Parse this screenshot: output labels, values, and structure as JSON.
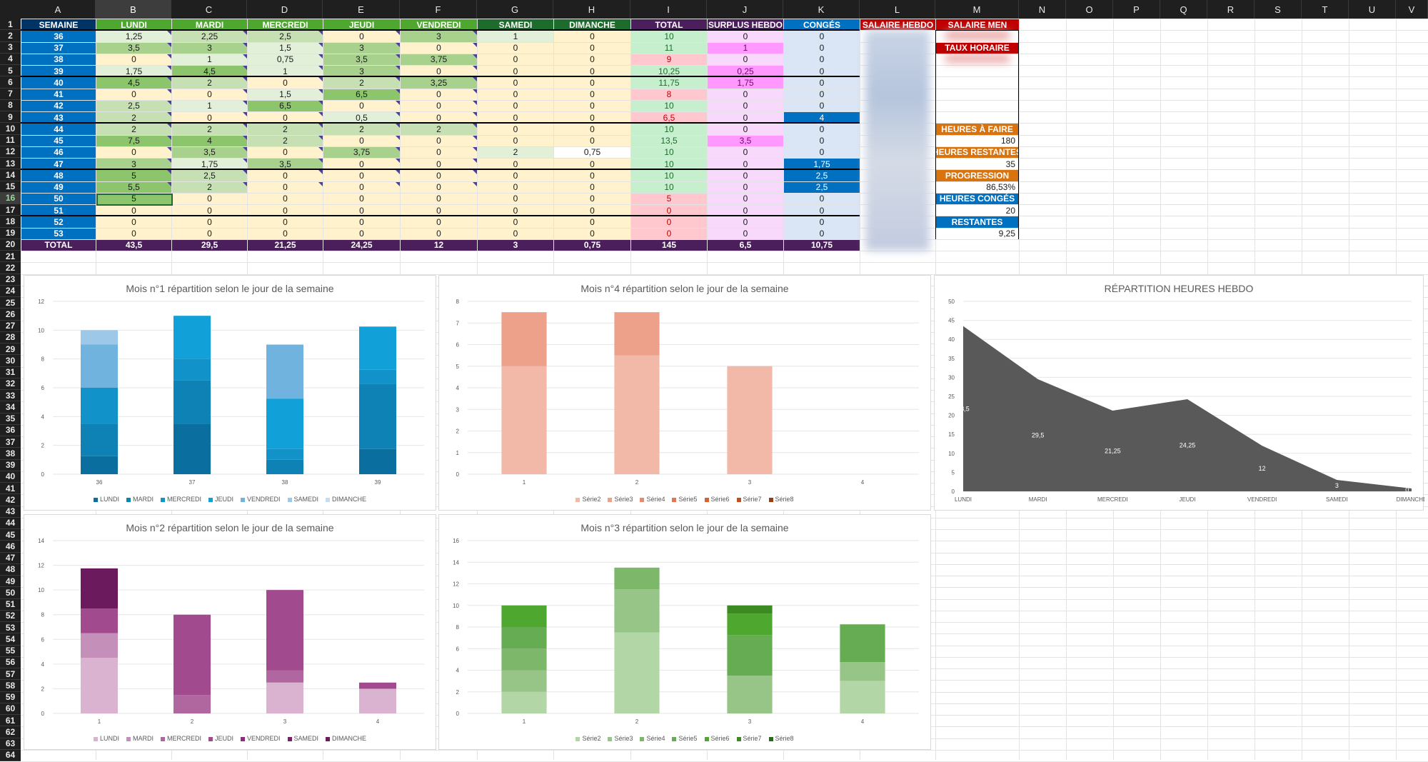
{
  "columns": [
    "A",
    "B",
    "C",
    "D",
    "E",
    "F",
    "G",
    "H",
    "I",
    "J",
    "K",
    "L",
    "M",
    "N",
    "O",
    "P",
    "Q",
    "R",
    "S",
    "T",
    "U",
    "V"
  ],
  "selected_column": "B",
  "selected_row": "16",
  "rows": [
    "1",
    "2",
    "3",
    "4",
    "5",
    "6",
    "7",
    "8",
    "9",
    "10",
    "11",
    "12",
    "13",
    "14",
    "15",
    "16",
    "17",
    "18",
    "19",
    "20",
    "21",
    "22",
    "23",
    "24",
    "25",
    "26",
    "27",
    "28",
    "29",
    "30",
    "31",
    "32",
    "33",
    "34",
    "35",
    "36",
    "37",
    "38",
    "39",
    "40",
    "41",
    "42",
    "43",
    "44",
    "45",
    "46",
    "47",
    "48",
    "49",
    "50",
    "51",
    "52",
    "53",
    "54",
    "55",
    "56",
    "57",
    "58",
    "59",
    "60",
    "61",
    "62",
    "63",
    "64"
  ],
  "table": {
    "headers": [
      "SEMAINE",
      "LUNDI",
      "MARDI",
      "MERCREDI",
      "JEUDI",
      "VENDREDI",
      "SAMEDI",
      "DIMANCHE",
      "TOTAL",
      "SURPLUS HEBDO",
      "CONGÉS",
      "SALAIRE HEBDO",
      "SALAIRE MEN"
    ],
    "header_colors": [
      "#003366",
      "#4ea72e",
      "#4ea72e",
      "#4ea72e",
      "#4ea72e",
      "#4ea72e",
      "#1e6b2e",
      "#1e6b2e",
      "#4b1f5c",
      "#4b1f5c",
      "#0070c0",
      "#c00000",
      "#c00000"
    ],
    "data": [
      [
        "36",
        "1,25",
        "2,25",
        "2,5",
        "0",
        "3",
        "1",
        "0",
        "10",
        "0",
        "0"
      ],
      [
        "37",
        "3,5",
        "3",
        "1,5",
        "3",
        "0",
        "0",
        "0",
        "11",
        "1",
        "0"
      ],
      [
        "38",
        "0",
        "1",
        "0,75",
        "3,5",
        "3,75",
        "0",
        "0",
        "9",
        "0",
        "0"
      ],
      [
        "39",
        "1,75",
        "4,5",
        "1",
        "3",
        "0",
        "0",
        "0",
        "10,25",
        "0,25",
        "0"
      ],
      [
        "40",
        "4,5",
        "2",
        "0",
        "2",
        "3,25",
        "0",
        "0",
        "11,75",
        "1,75",
        "0"
      ],
      [
        "41",
        "0",
        "0",
        "1,5",
        "6,5",
        "0",
        "0",
        "0",
        "8",
        "0",
        "0"
      ],
      [
        "42",
        "2,5",
        "1",
        "6,5",
        "0",
        "0",
        "0",
        "0",
        "10",
        "0",
        "0"
      ],
      [
        "43",
        "2",
        "0",
        "0",
        "0,5",
        "0",
        "0",
        "0",
        "6,5",
        "0",
        "4"
      ],
      [
        "44",
        "2",
        "2",
        "2",
        "2",
        "2",
        "0",
        "0",
        "10",
        "0",
        "0"
      ],
      [
        "45",
        "7,5",
        "4",
        "2",
        "0",
        "0",
        "0",
        "0",
        "13,5",
        "3,5",
        "0"
      ],
      [
        "46",
        "0",
        "3,5",
        "0",
        "3,75",
        "0",
        "2",
        "0,75",
        "10",
        "0",
        "0"
      ],
      [
        "47",
        "3",
        "1,75",
        "3,5",
        "0",
        "0",
        "0",
        "0",
        "10",
        "0",
        "1,75"
      ],
      [
        "48",
        "5",
        "2,5",
        "0",
        "0",
        "0",
        "0",
        "0",
        "10",
        "0",
        "2,5"
      ],
      [
        "49",
        "5,5",
        "2",
        "0",
        "0",
        "0",
        "0",
        "0",
        "10",
        "0",
        "2,5"
      ],
      [
        "50",
        "5",
        "0",
        "0",
        "0",
        "0",
        "0",
        "0",
        "5",
        "0",
        "0"
      ],
      [
        "51",
        "0",
        "0",
        "0",
        "0",
        "0",
        "0",
        "0",
        "0",
        "0",
        "0"
      ],
      [
        "52",
        "0",
        "0",
        "0",
        "0",
        "0",
        "0",
        "0",
        "0",
        "0",
        "0"
      ],
      [
        "53",
        "0",
        "0",
        "0",
        "0",
        "0",
        "0",
        "0",
        "0",
        "0",
        "0"
      ]
    ],
    "totals": [
      "TOTAL",
      "43,5",
      "29,5",
      "21,25",
      "24,25",
      "12",
      "3",
      "0,75",
      "145",
      "6,5",
      "10,75"
    ]
  },
  "side_panel": {
    "taux_horaire": "TAUX HORAIRE",
    "heures_a_faire_label": "HEURES À FAIRE",
    "heures_a_faire": "180",
    "heures_restantes_label": "HEURES RESTANTES",
    "heures_restantes": "35",
    "progression_label": "PROGRESSION",
    "progression": "86,53%",
    "heures_conges_label": "HEURES CONGÉS",
    "heures_conges": "20",
    "restantes_label": "RESTANTES",
    "restantes": "9,25",
    "colors": {
      "orange": "#d9730d",
      "blue": "#0070c0",
      "red": "#c00000"
    }
  },
  "chart_data": [
    {
      "id": "mois1",
      "type": "bar",
      "stacked": true,
      "title": "Mois n°1 répartition selon le jour de la semaine",
      "categories": [
        "36",
        "37",
        "38",
        "39"
      ],
      "ylim": [
        0,
        12
      ],
      "yticks": [
        0,
        2,
        4,
        6,
        8,
        10,
        12
      ],
      "series": [
        {
          "name": "LUNDI",
          "values": [
            1.25,
            3.5,
            0,
            1.75
          ],
          "color": "#0a6e9e"
        },
        {
          "name": "MARDI",
          "values": [
            2.25,
            3,
            1,
            4.5
          ],
          "color": "#0e81b5"
        },
        {
          "name": "MERCREDI",
          "values": [
            2.5,
            1.5,
            0.75,
            1
          ],
          "color": "#1192c9"
        },
        {
          "name": "JEUDI",
          "values": [
            0,
            3,
            3.5,
            3
          ],
          "color": "#12a0d8"
        },
        {
          "name": "VENDREDI",
          "values": [
            3,
            0,
            3.75,
            0
          ],
          "color": "#6fb3de"
        },
        {
          "name": "SAMEDI",
          "values": [
            1,
            0,
            0,
            0
          ],
          "color": "#9dc8e8"
        },
        {
          "name": "DIMANCHE",
          "values": [
            0,
            0,
            0,
            0
          ],
          "color": "#c4ddf0"
        }
      ]
    },
    {
      "id": "mois4",
      "type": "bar",
      "stacked": true,
      "title": "Mois n°4 répartition selon le jour de la semaine",
      "categories": [
        "1",
        "2",
        "3",
        "4"
      ],
      "ylim": [
        0,
        8
      ],
      "yticks": [
        0,
        1,
        2,
        3,
        4,
        5,
        6,
        7,
        8
      ],
      "series": [
        {
          "name": "Série2",
          "values": [
            5,
            5.5,
            5,
            0
          ],
          "color": "#f2b8a8"
        },
        {
          "name": "Série3",
          "values": [
            2.5,
            2,
            0,
            0
          ],
          "color": "#eda08a"
        },
        {
          "name": "Série4",
          "values": [
            0,
            0,
            0,
            0
          ],
          "color": "#e98a6e"
        },
        {
          "name": "Série5",
          "values": [
            0,
            0,
            0,
            0
          ],
          "color": "#e57550"
        },
        {
          "name": "Série6",
          "values": [
            0,
            0,
            0,
            0
          ],
          "color": "#d9622f"
        },
        {
          "name": "Série7",
          "values": [
            0,
            0,
            0,
            0
          ],
          "color": "#c05020"
        },
        {
          "name": "Série8",
          "values": [
            0,
            0,
            0,
            0
          ],
          "color": "#9c3c14"
        }
      ]
    },
    {
      "id": "hebdo",
      "type": "area",
      "title": "RÉPARTITION HEURES HEBDO",
      "categories": [
        "LUNDI",
        "MARDI",
        "MERCREDI",
        "JEUDI",
        "VENDREDI",
        "SAMEDI",
        "DIMANCHE"
      ],
      "values": [
        43.5,
        29.5,
        21.25,
        24.25,
        12,
        3,
        0.75
      ],
      "value_labels": [
        "43,5",
        "29,5",
        "21,25",
        "24,25",
        "12",
        "3",
        "0,75"
      ],
      "ylim": [
        0,
        50
      ],
      "yticks": [
        0,
        5,
        10,
        15,
        20,
        25,
        30,
        35,
        40,
        45,
        50
      ],
      "color": "#595959"
    },
    {
      "id": "mois2",
      "type": "bar",
      "stacked": true,
      "title": "Mois n°2 répartition selon le jour de la semaine",
      "categories": [
        "1",
        "2",
        "3",
        "4"
      ],
      "ylim": [
        0,
        14
      ],
      "yticks": [
        0,
        2,
        4,
        6,
        8,
        10,
        12,
        14
      ],
      "series": [
        {
          "name": "LUNDI",
          "values": [
            4.5,
            0,
            2.5,
            2
          ],
          "color": "#d9b3cf"
        },
        {
          "name": "MARDI",
          "values": [
            2,
            0,
            0,
            0
          ],
          "color": "#c48fb8"
        },
        {
          "name": "MERCREDI",
          "values": [
            0,
            1.5,
            1,
            0
          ],
          "color": "#b067a0"
        },
        {
          "name": "JEUDI",
          "values": [
            2,
            6.5,
            6.5,
            0.5
          ],
          "color": "#a24a8e"
        },
        {
          "name": "VENDREDI",
          "values": [
            0,
            0,
            0,
            0
          ],
          "color": "#8f2a7c"
        },
        {
          "name": "SAMEDI",
          "values": [
            0,
            0,
            0,
            0
          ],
          "color": "#7a1f6b"
        },
        {
          "name": "DIMANCHE",
          "values": [
            3.25,
            0,
            0,
            0
          ],
          "color": "#6b1a5e"
        }
      ]
    },
    {
      "id": "mois3",
      "type": "bar",
      "stacked": true,
      "title": "Mois n°3 répartition selon le jour de la semaine",
      "categories": [
        "1",
        "2",
        "3",
        "4"
      ],
      "ylim": [
        0,
        16
      ],
      "yticks": [
        0,
        2,
        4,
        6,
        8,
        10,
        12,
        14,
        16
      ],
      "series": [
        {
          "name": "Série2",
          "values": [
            2,
            7.5,
            0,
            3
          ],
          "color": "#b3d6a6"
        },
        {
          "name": "Série3",
          "values": [
            2,
            4,
            3.5,
            1.75
          ],
          "color": "#97c587"
        },
        {
          "name": "Série4",
          "values": [
            2,
            2,
            0,
            0
          ],
          "color": "#7db86a"
        },
        {
          "name": "Série5",
          "values": [
            2,
            0,
            3.75,
            3.5
          ],
          "color": "#66ac52"
        },
        {
          "name": "Série6",
          "values": [
            2,
            0,
            2,
            0
          ],
          "color": "#4ea72e"
        },
        {
          "name": "Série7",
          "values": [
            0,
            0,
            0.75,
            0
          ],
          "color": "#3b8a22"
        },
        {
          "name": "Série8",
          "values": [
            0,
            0,
            0,
            0
          ],
          "color": "#2b6a18"
        }
      ]
    }
  ]
}
